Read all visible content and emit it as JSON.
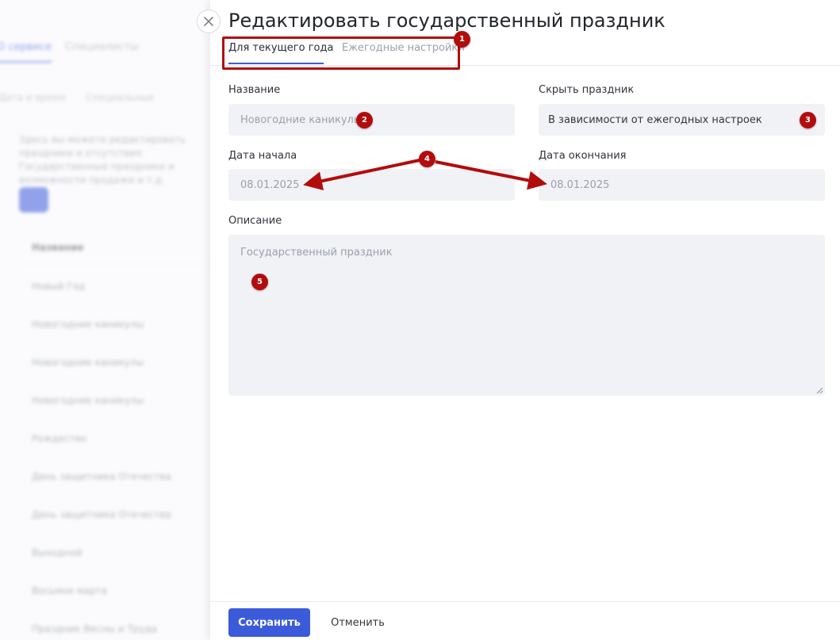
{
  "background": {
    "tabs": [
      "О сервисе",
      "Специалисты"
    ],
    "breadcrumb": [
      "Дата и время",
      "Специальные"
    ],
    "intro": "Здесь вы можете редактировать праздники и отсутствия. Государственные праздники и возможности продажи и т.д.",
    "table_header": "Название",
    "rows": [
      "Новый Год",
      "Новогодние каникулы",
      "Новогодние каникулы",
      "Новогодние каникулы",
      "Рождество",
      "День защитника Отечества",
      "День защитника Отечества",
      "Выходной",
      "Восьмое марта",
      "Праздник Весны и Труда"
    ]
  },
  "modal": {
    "title": "Редактировать государственный праздник",
    "tabs": [
      {
        "label": "Для текущего года",
        "active": true
      },
      {
        "label": "Ежегодные настройки",
        "active": false
      }
    ],
    "fields": {
      "name": {
        "label": "Название",
        "placeholder": "Новогодние каникулы"
      },
      "hide": {
        "label": "Скрыть праздник",
        "value": "В зависимости от ежегодных настроек"
      },
      "start_date": {
        "label": "Дата начала",
        "value": "08.01.2025"
      },
      "end_date": {
        "label": "Дата окончания",
        "value": "08.01.2025"
      },
      "description": {
        "label": "Описание",
        "placeholder": "Государственный праздник"
      }
    },
    "buttons": {
      "save": "Сохранить",
      "cancel": "Отменить"
    }
  },
  "annotations": {
    "badges": [
      "1",
      "2",
      "3",
      "4",
      "5"
    ],
    "color": "#b30c0c"
  },
  "colors": {
    "accent": "#3b5bdb",
    "field_bg": "#f1f2f6",
    "annotation": "#b30c0c"
  }
}
